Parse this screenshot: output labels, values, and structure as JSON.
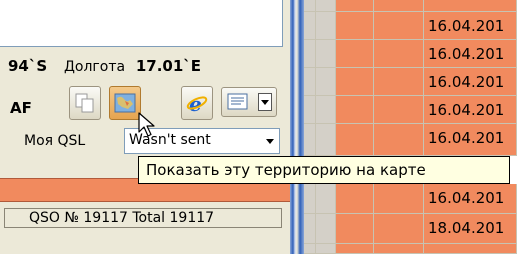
{
  "coords": {
    "lat": "94`S",
    "lon_label": "Долгота",
    "lon": "17.01`E"
  },
  "continent": "AF",
  "toolbar": {
    "buttons": [
      {
        "icon": "copy-icon"
      },
      {
        "icon": "map-icon"
      },
      {
        "icon": "internet-explorer-icon"
      }
    ],
    "dropdown_icon": "list-icon"
  },
  "qsl": {
    "label": "Моя QSL",
    "value": "Wasn't sent"
  },
  "status": {
    "text": "QSO № 19117 Total 19117"
  },
  "tooltip": {
    "text": "Показать эту территорию на карте"
  },
  "grid": {
    "dates": [
      "16.04.201",
      "16.04.201",
      "16.04.201",
      "16.04.201",
      "16.04.201",
      "16.04.201",
      "18.04.201"
    ]
  },
  "colors": {
    "orange": "#f18a5e",
    "tooltip_bg": "#ffffe1",
    "splitter": "#2f5fb8"
  }
}
